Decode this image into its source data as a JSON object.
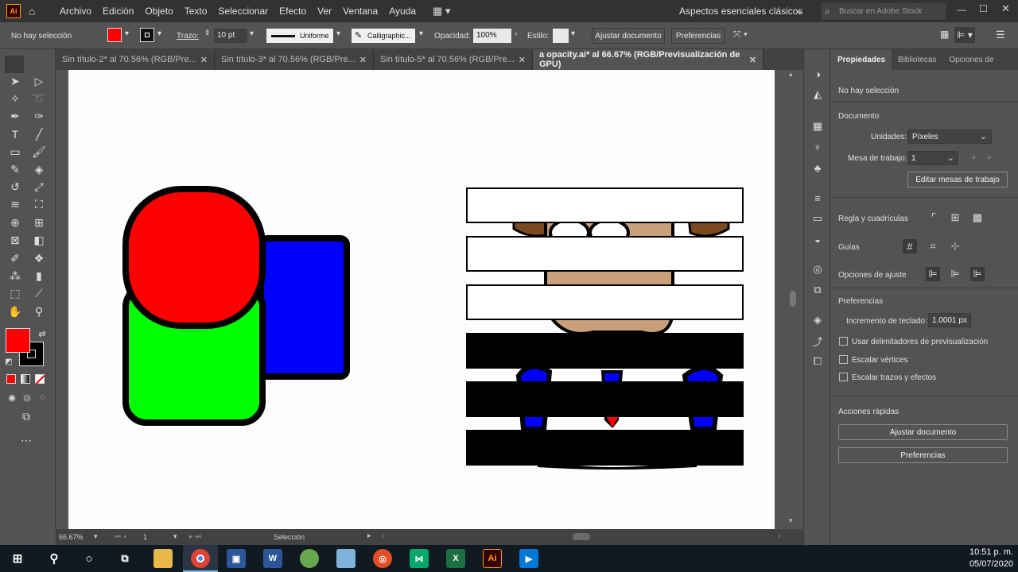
{
  "app": {
    "logo": "Ai",
    "workspace": "Aspectos esenciales clásicos",
    "search_placeholder": "Buscar en Adobe Stock"
  },
  "menu": [
    "Archivo",
    "Edición",
    "Objeto",
    "Texto",
    "Seleccionar",
    "Efecto",
    "Ver",
    "Ventana",
    "Ayuda"
  ],
  "control": {
    "selection": "No hay selección",
    "fill_color": "#ff0000",
    "stroke_label": "Trazo:",
    "stroke_value": "10 pt",
    "profile": "Uniforme",
    "brush": "Calligraphic...",
    "opacity_label": "Opacidad:",
    "opacity_value": "100%",
    "style_label": "Estilo:",
    "fit_document": "Ajustar documento",
    "preferences": "Preferencias"
  },
  "tabs": [
    {
      "label": "Sin título-2* al 70.56% (RGB/Pre...",
      "active": false
    },
    {
      "label": "Sin título-3* al 70.56% (RGB/Pre...",
      "active": false
    },
    {
      "label": "Sin título-5* al 70.56% (RGB/Pre...",
      "active": false
    },
    {
      "label": "a opacity.ai* al 66.67% (RGB/Previsualización de GPU)",
      "active": true
    }
  ],
  "status": {
    "zoom": "66.67%",
    "artboard": "1",
    "tool": "Selección"
  },
  "panel": {
    "tabs": [
      "Propiedades",
      "Bibliotecas",
      "Opciones de"
    ],
    "no_selection": "No hay selección",
    "document_heading": "Documento",
    "units_label": "Unidades:",
    "units_value": "Píxeles",
    "artboard_label": "Mesa de trabajo:",
    "artboard_value": "1",
    "edit_artboards": "Editar mesas de trabajo",
    "rulers_label": "Regla y cuadrículas",
    "guides_label": "Guías",
    "snap_label": "Opciones de ajuste",
    "prefs_heading": "Preferencias",
    "keyboard_label": "Incremento de teclado:",
    "keyboard_value": "1.0001 px",
    "chk_preview": "Usar delimitadores de previsualización",
    "chk_corners": "Escalar vértices",
    "chk_strokes": "Escalar trazos y efectos",
    "quick_actions": "Acciones rápidas",
    "btn_fit": "Ajustar documento",
    "btn_prefs": "Preferencias"
  },
  "taskbar": {
    "time": "10:51 p. m.",
    "date": "05/07/2020"
  },
  "colors": {
    "red": "#ff0000",
    "green": "#00ff00",
    "blue": "#0000ff",
    "skin": "#c8a07a",
    "brown": "#7a4a1e"
  }
}
